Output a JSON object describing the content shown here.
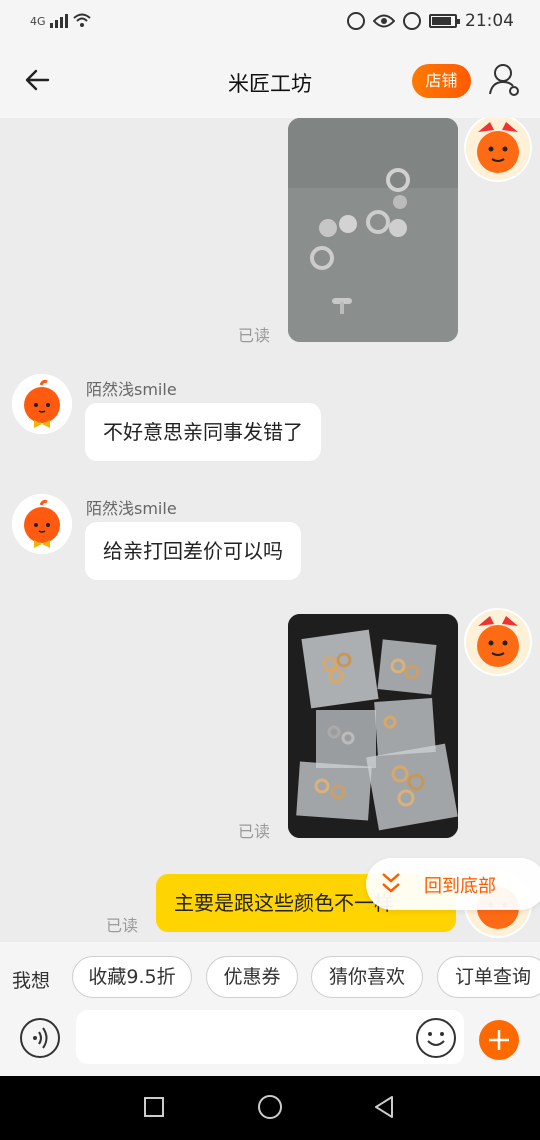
{
  "status_bar": {
    "network": "4G",
    "time": "21:04",
    "icons": [
      "signal-icon",
      "wifi-icon",
      "data-saver-icon",
      "eye-comfort-icon",
      "alarm-icon",
      "battery-icon"
    ]
  },
  "header": {
    "title": "米匠工坊",
    "shop_button": "店铺",
    "icons": [
      "back-arrow-icon",
      "user-settings-icon"
    ]
  },
  "messages": [
    {
      "type": "image",
      "from": "me",
      "read": "已读",
      "image_desc": "metal-rings"
    },
    {
      "type": "text",
      "from": "them",
      "sender": "陌然浅smile",
      "text": "不好意思亲同事发错了"
    },
    {
      "type": "text",
      "from": "them",
      "sender": "陌然浅smile",
      "text": "给亲打回差价可以吗"
    },
    {
      "type": "image",
      "from": "me",
      "read": "已读",
      "image_desc": "bags-of-rings"
    },
    {
      "type": "text",
      "from": "me",
      "read": "已读",
      "text": "主要是跟这些颜色不一样"
    }
  ],
  "scroll_pill": {
    "label": "回到底部"
  },
  "quick_bar": {
    "lead": "我想",
    "chips": [
      "收藏9.5折",
      "优惠券",
      "猜你喜欢",
      "订单查询"
    ]
  },
  "input_bar": {
    "placeholder": ""
  },
  "colors": {
    "accent": "#ff6a00",
    "my_bubble": "#ffd400",
    "bg": "#ececec"
  }
}
